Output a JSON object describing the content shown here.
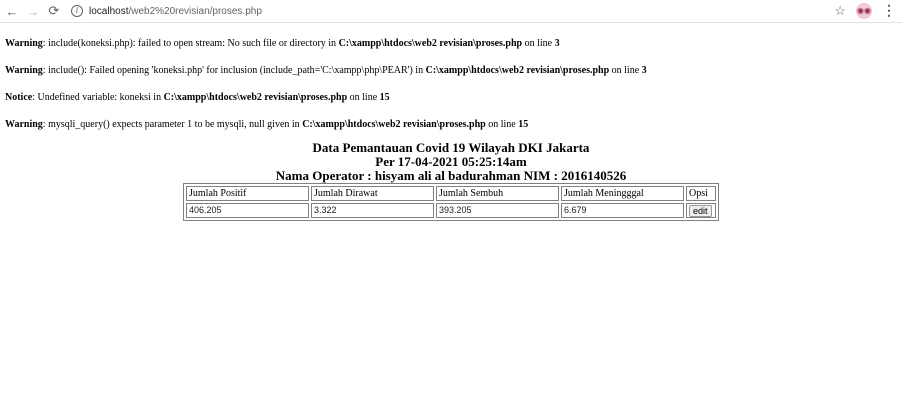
{
  "browser": {
    "url_host": "localhost",
    "url_path": "/web2%20revisian/proses.php",
    "back_icon": "arrow-left",
    "forward_icon": "arrow-right",
    "reload_icon": "reload",
    "info_icon": "info",
    "star_icon": "star",
    "menu_icon": "kebab-menu"
  },
  "messages": [
    {
      "type": "Warning",
      "text": ": include(koneksi.php): failed to open stream: No such file or directory in ",
      "path": "C:\\xampp\\htdocs\\web2 revisian\\proses.php",
      "on_line": " on line ",
      "line": "3"
    },
    {
      "type": "Warning",
      "text": ": include(): Failed opening 'koneksi.php' for inclusion (include_path='C:\\xampp\\php\\PEAR') in ",
      "path": "C:\\xampp\\htdocs\\web2 revisian\\proses.php",
      "on_line": " on line ",
      "line": "3"
    },
    {
      "type": "Notice",
      "text": ": Undefined variable: koneksi in ",
      "path": "C:\\xampp\\htdocs\\web2 revisian\\proses.php",
      "on_line": " on line ",
      "line": "15"
    },
    {
      "type": "Warning",
      "text": ": mysqli_query() expects parameter 1 to be mysqli, null given in ",
      "path": "C:\\xampp\\htdocs\\web2 revisian\\proses.php",
      "on_line": " on line ",
      "line": "15"
    }
  ],
  "headings": {
    "title": "Data Pemantauan Covid 19 Wilayah DKI Jakarta",
    "date": "Per 17-04-2021 05:25:14am",
    "operator": "Nama Operator : hisyam ali al badurahman NIM : 2016140526"
  },
  "table": {
    "headers": [
      "Jumlah Positif",
      "Jumlah Dirawat",
      "Jumlah Sembuh",
      "Jumlah Meningggal",
      "Opsi"
    ],
    "row": [
      "406.205",
      "3.322",
      "393.205",
      "6.679"
    ],
    "edit_label": "edit"
  }
}
